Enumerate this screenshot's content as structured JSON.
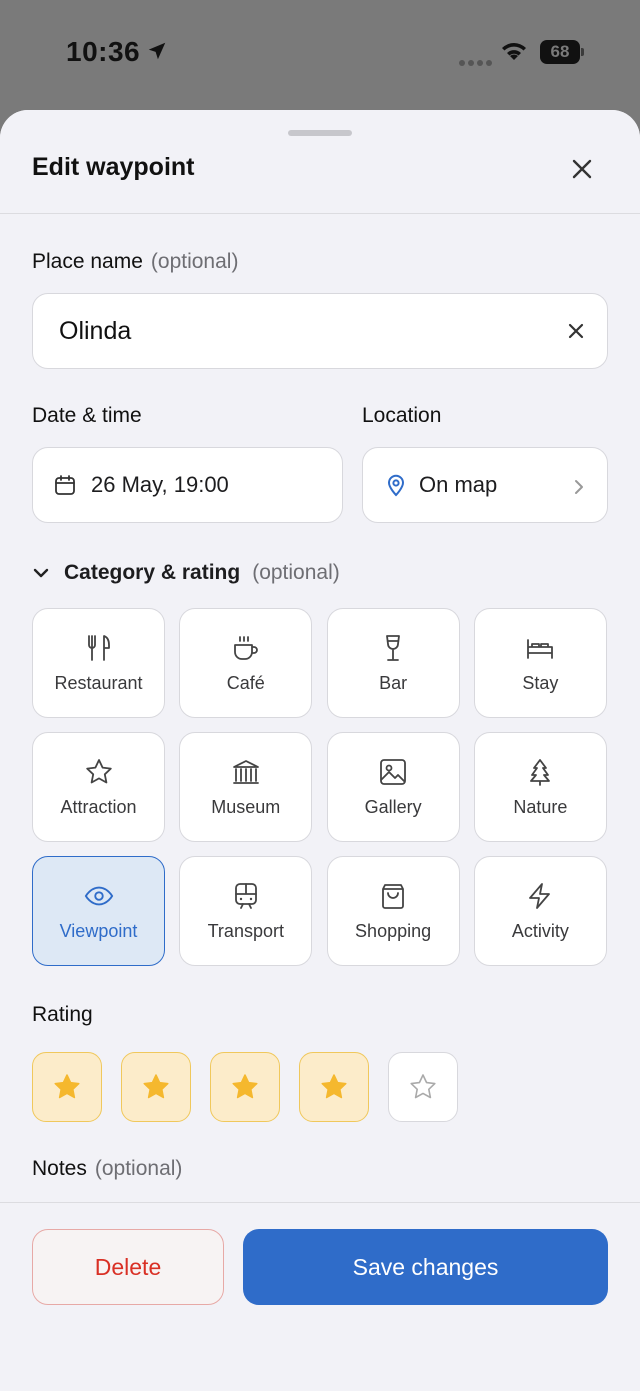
{
  "status_bar": {
    "time": "10:36",
    "battery": "68"
  },
  "sheet": {
    "title": "Edit waypoint"
  },
  "place_name": {
    "label": "Place name",
    "optional": "(optional)",
    "value": "Olinda"
  },
  "date_time": {
    "label": "Date & time",
    "value": "26 May, 19:00"
  },
  "location": {
    "label": "Location",
    "value": "On map"
  },
  "category_section": {
    "title": "Category & rating",
    "optional": "(optional)"
  },
  "categories": [
    {
      "label": "Restaurant",
      "icon": "fork-knife-icon",
      "selected": false
    },
    {
      "label": "Café",
      "icon": "coffee-cup-icon",
      "selected": false
    },
    {
      "label": "Bar",
      "icon": "wine-glass-icon",
      "selected": false
    },
    {
      "label": "Stay",
      "icon": "bed-icon",
      "selected": false
    },
    {
      "label": "Attraction",
      "icon": "star-icon",
      "selected": false
    },
    {
      "label": "Museum",
      "icon": "museum-icon",
      "selected": false
    },
    {
      "label": "Gallery",
      "icon": "image-icon",
      "selected": false
    },
    {
      "label": "Nature",
      "icon": "tree-icon",
      "selected": false
    },
    {
      "label": "Viewpoint",
      "icon": "eye-icon",
      "selected": true
    },
    {
      "label": "Transport",
      "icon": "train-icon",
      "selected": false
    },
    {
      "label": "Shopping",
      "icon": "shopping-bag-icon",
      "selected": false
    },
    {
      "label": "Activity",
      "icon": "lightning-icon",
      "selected": false
    }
  ],
  "rating": {
    "label": "Rating",
    "value": 4,
    "max": 5
  },
  "notes": {
    "label": "Notes",
    "optional": "(optional)"
  },
  "actions": {
    "delete": "Delete",
    "save": "Save changes"
  },
  "colors": {
    "accent": "#2f6cc9",
    "danger": "#d93025",
    "star": "#f5b82e",
    "selected_bg": "#dde8f5"
  }
}
